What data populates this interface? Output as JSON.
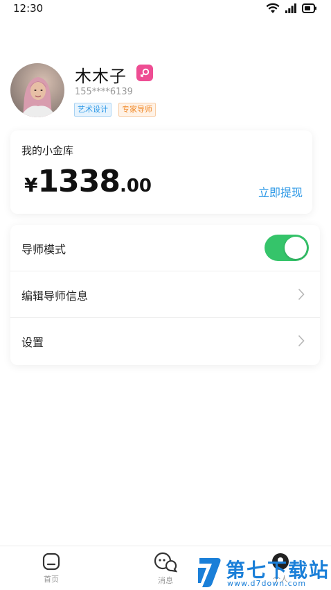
{
  "status_bar": {
    "time": "12:30"
  },
  "profile": {
    "name": "木木子",
    "phone": "155****6139",
    "tags": [
      "艺术设计",
      "专家导师"
    ]
  },
  "wallet": {
    "title": "我的小金库",
    "currency": "¥",
    "amount_integer": "1338",
    "amount_decimal": ".00",
    "withdraw_label": "立即提现"
  },
  "settings": {
    "mentor_mode_label": "导师模式",
    "mentor_mode_on": true,
    "edit_mentor_info_label": "编辑导师信息",
    "settings_label": "设置"
  },
  "tab_bar": {
    "home_label": "首页",
    "messages_label": "消息",
    "profile_label": "个人"
  },
  "watermark": {
    "title": "第七下载站",
    "url": "www.d7down.com"
  },
  "colors": {
    "accent_blue": "#2a97e6",
    "toggle_green": "#35c46a",
    "gender_pink": "#ee4d93",
    "tag_orange": "#f08a2a"
  }
}
